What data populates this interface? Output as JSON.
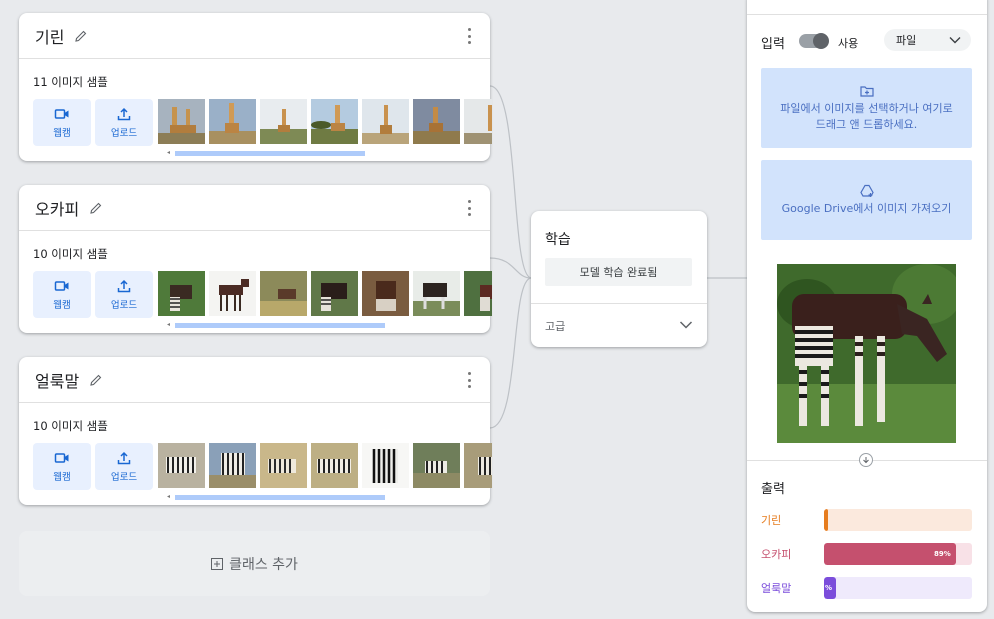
{
  "classes": [
    {
      "name": "기린",
      "samples": "11 이미지 샘플",
      "thumb_count": 7
    },
    {
      "name": "오카피",
      "samples": "10 이미지 샘플",
      "thumb_count": 7
    },
    {
      "name": "얼룩말",
      "samples": "10 이미지 샘플",
      "thumb_count": 7
    }
  ],
  "add_buttons": {
    "webcam": "웹캠",
    "upload": "업로드"
  },
  "add_class": "클래스 추가",
  "training": {
    "title": "학습",
    "status_button": "모델 학습 완료됨",
    "advanced": "고급"
  },
  "preview": {
    "input_label": "입력",
    "toggle_label": "사용",
    "source_select": "파일",
    "file_drop": "파일에서 이미지를 선택하거나 여기로 드래그 앤 드롭하세요.",
    "drive_brand": "Google Drive",
    "drive_text": "에서 이미지 가져오기",
    "output_title": "출력",
    "results": [
      {
        "label": "기린",
        "fraction": 0.02,
        "pct": "",
        "color": "#e67c1e",
        "track": "#fbe9dd"
      },
      {
        "label": "오카피",
        "fraction": 0.89,
        "pct": "89%",
        "color": "#c5506e",
        "track": "#f8e1e7"
      },
      {
        "label": "얼룩말",
        "fraction": 0.08,
        "pct": "%",
        "color": "#7b4ddb",
        "track": "#efeafc"
      }
    ]
  }
}
